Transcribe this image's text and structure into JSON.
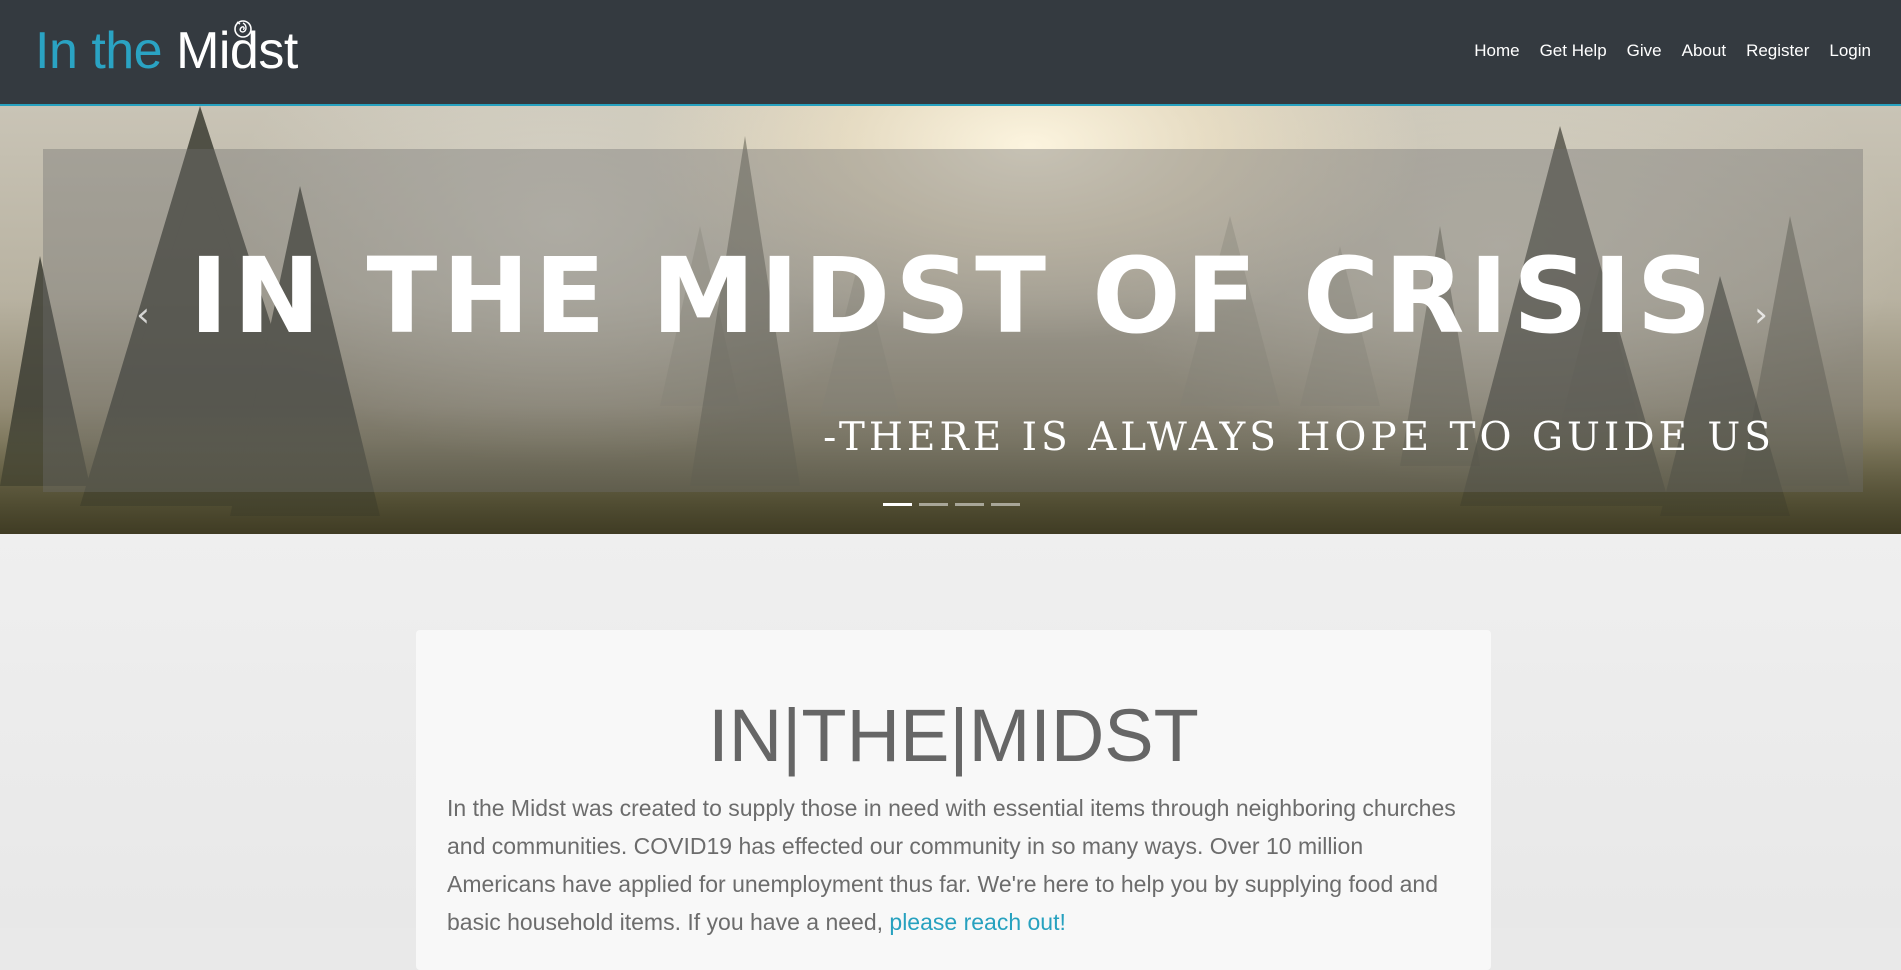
{
  "navbar": {
    "brand_accent": "In the",
    "brand_white": "Midst",
    "links": [
      "Home",
      "Get Help",
      "Give",
      "About",
      "Register",
      "Login"
    ]
  },
  "hero": {
    "title": "IN THE MIDST OF CRISIS",
    "subtitle": "-THERE IS ALWAYS HOPE TO GUIDE US",
    "prev_icon": "‹",
    "next_icon": "›",
    "slide_count": 4,
    "active_slide": 1
  },
  "about": {
    "title": "IN|THE|MIDST",
    "text": "In the Midst was created to supply those in need with essential items through neighboring churches and communities. COVID19 has effected our community in so many ways. Over 10 million Americans have applied for unemployment thus far. We're here to help you by supplying food and basic household items. If you have a need,",
    "link_text": "please reach out!"
  },
  "colors": {
    "navbar_bg": "#343a40",
    "accent": "#2aa3c3",
    "link": "#27a1bf"
  }
}
